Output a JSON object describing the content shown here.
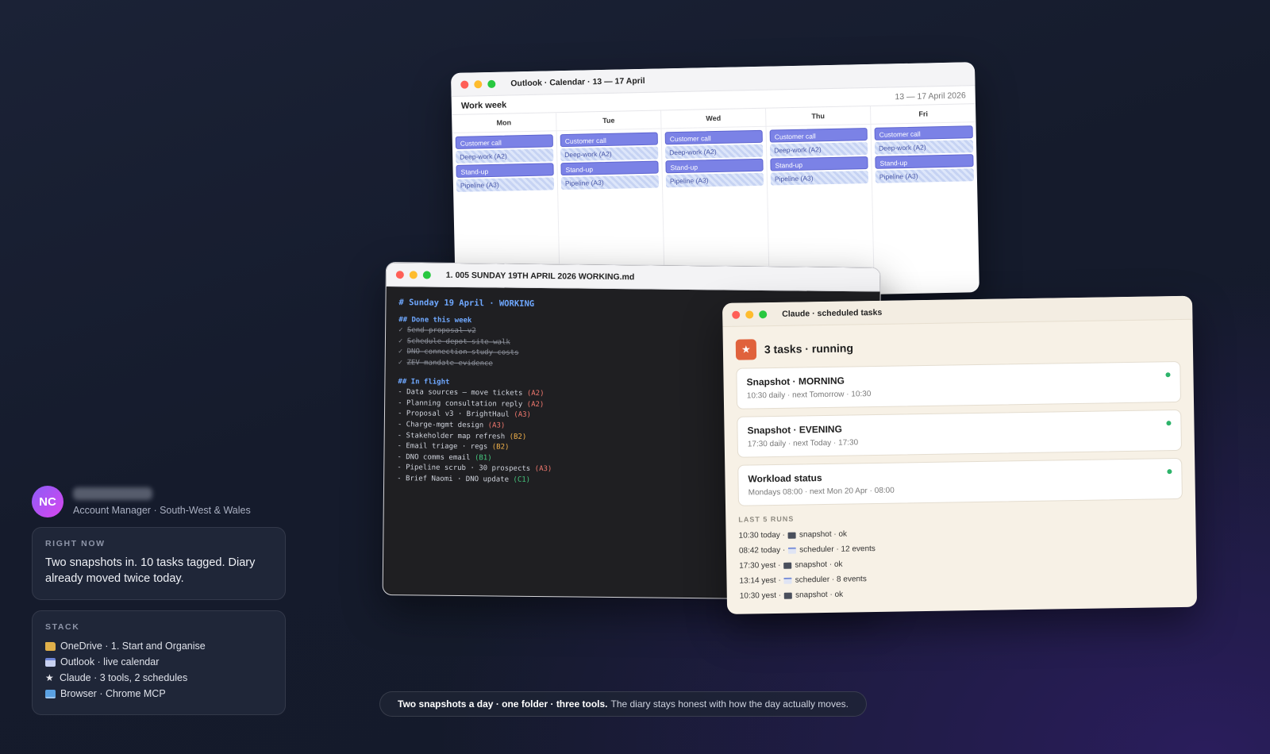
{
  "profile": {
    "initials": "NC",
    "role": "Account Manager · South-West & Wales"
  },
  "right_now": {
    "title": "RIGHT NOW",
    "text": "Two snapshots in. 10 tasks tagged. Diary already moved twice today."
  },
  "stack": {
    "title": "STACK",
    "items": [
      {
        "icon": "folder-icon",
        "label": "OneDrive · 1. Start and Organise"
      },
      {
        "icon": "calendar-icon",
        "label": "Outlook · live calendar"
      },
      {
        "icon": "star-icon",
        "label": "Claude · 3 tools, 2 schedules"
      },
      {
        "icon": "laptop-icon",
        "label": "Browser · Chrome MCP"
      }
    ]
  },
  "calendar_window": {
    "title": "Outlook · Calendar · 13 — 17 April",
    "view_label": "Work week",
    "range": "13 — 17 April 2026",
    "days": [
      {
        "name": "Mon",
        "events": [
          "Customer call",
          "Deep-work (A2)",
          "Stand-up",
          "Pipeline (A3)"
        ]
      },
      {
        "name": "Tue",
        "events": [
          "Customer call",
          "Deep-work (A2)",
          "Stand-up",
          "Pipeline (A3)"
        ]
      },
      {
        "name": "Wed",
        "events": [
          "Customer call",
          "Deep-work (A2)",
          "Stand-up",
          "Pipeline (A3)"
        ]
      },
      {
        "name": "Thu",
        "events": [
          "Customer call",
          "Deep-work (A2)",
          "Stand-up",
          "Pipeline (A3)"
        ]
      },
      {
        "name": "Fri",
        "events": [
          "Customer call",
          "Deep-work (A2)",
          "Stand-up",
          "Pipeline (A3)"
        ]
      }
    ]
  },
  "markdown_window": {
    "title": "1. 005 SUNDAY 19TH APRIL 2026 WORKING.md",
    "heading": "# Sunday 19 April · WORKING",
    "done_heading": "## Done this week",
    "done_items": [
      "Send proposal v2",
      "Schedule depot site walk",
      "DNO connection study costs",
      "ZEV mandate evidence"
    ],
    "flight_heading": "## In flight",
    "flight_items": [
      {
        "text": "- Data sources — move tickets",
        "tag": "(A2)"
      },
      {
        "text": "- Planning consultation reply",
        "tag": "(A2)"
      },
      {
        "text": "- Proposal v3 · BrightHaul",
        "tag": "(A3)"
      },
      {
        "text": "- Charge-mgmt design",
        "tag": "(A3)"
      },
      {
        "text": "- Stakeholder map refresh",
        "tag": "(B2)"
      },
      {
        "text": "- Email triage · regs",
        "tag": "(B2)"
      },
      {
        "text": "- DNO comms email",
        "tag": "(B1)"
      },
      {
        "text": "- Pipeline scrub · 30 prospects",
        "tag": "(A3)"
      },
      {
        "text": "- Brief Naomi · DNO update",
        "tag": "(C1)"
      }
    ]
  },
  "claude_window": {
    "title": "Claude · scheduled tasks",
    "header": "3 tasks · running",
    "tasks": [
      {
        "name": "Snapshot · MORNING",
        "schedule": "10:30 daily · next Tomorrow · 10:30"
      },
      {
        "name": "Snapshot · EVENING",
        "schedule": "17:30 daily · next Today · 17:30"
      },
      {
        "name": "Workload status",
        "schedule": "Mondays 08:00 · next Mon 20 Apr · 08:00"
      }
    ],
    "runs_title": "LAST 5 RUNS",
    "runs": [
      {
        "when": "10:30 today ·",
        "icon": "camera-icon",
        "what": "snapshot · ok"
      },
      {
        "when": "08:42 today ·",
        "icon": "calendar-icon",
        "what": "scheduler · 12 events"
      },
      {
        "when": "17:30 yest ·",
        "icon": "camera-icon",
        "what": "snapshot · ok"
      },
      {
        "when": "13:14 yest ·",
        "icon": "calendar-icon",
        "what": "scheduler · 8 events"
      },
      {
        "when": "10:30 yest ·",
        "icon": "camera-icon",
        "what": "snapshot · ok"
      }
    ]
  },
  "caption": {
    "bold": "Two snapshots a day · one folder · three tools.",
    "rest": "The diary stays honest with how the day actually moves."
  },
  "colors": {
    "accent_purple": "#7b82e6",
    "claude_orange": "#e0623c",
    "status_green": "#2db36a",
    "markdown_heading": "#6fa8ff"
  }
}
